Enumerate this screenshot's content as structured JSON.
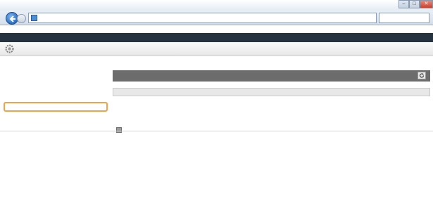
{
  "window": {
    "address": "",
    "addr_tools": ""
  },
  "header": {
    "left": "",
    "center": "",
    "right": ""
  },
  "page": {
    "title": "",
    "portal_link": ""
  },
  "sidebar": {
    "items": [
      "",
      "",
      "",
      "",
      "",
      "",
      "",
      ""
    ],
    "highlighted_index": 4
  },
  "main": {
    "breadcrumb": "",
    "title": "",
    "last_updated": "",
    "section_title": "",
    "spec_label": "",
    "spec_values": [
      "",
      ""
    ]
  },
  "footer": {
    "copyright": ""
  },
  "colors": {
    "highlight": "#f2a24a",
    "header_bg": "#25323f"
  },
  "icons": {
    "back": "back-arrow-icon",
    "gear": "gear-icon",
    "refresh": "refresh-icon"
  }
}
